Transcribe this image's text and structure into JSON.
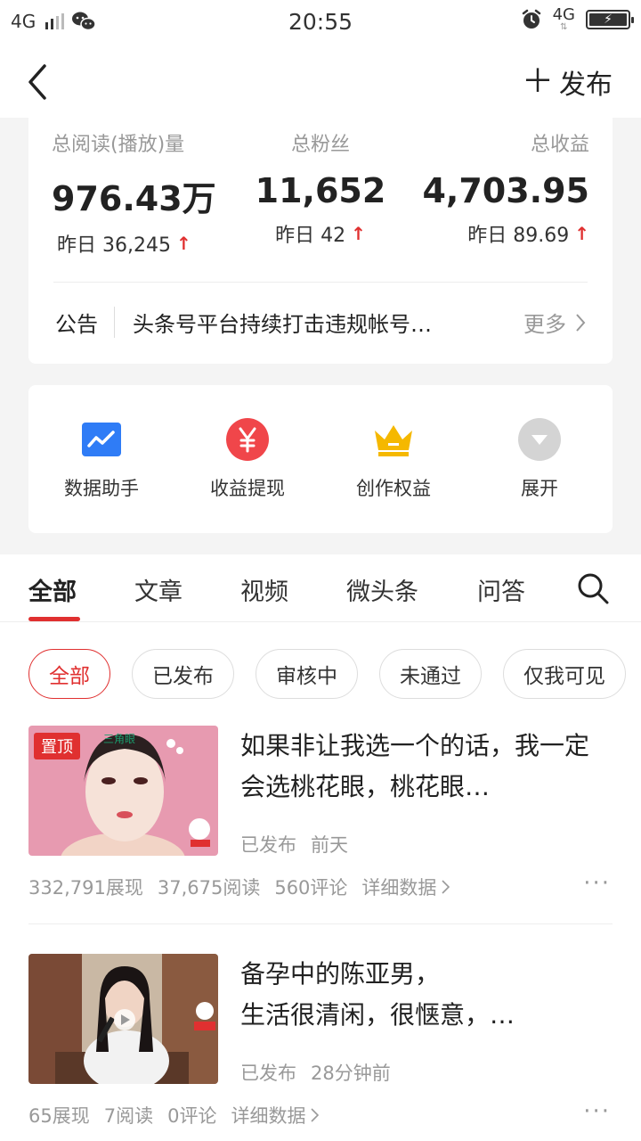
{
  "status_bar": {
    "network": "4G",
    "time": "20:55",
    "network_right": "4G"
  },
  "nav": {
    "publish_label": "发布"
  },
  "stats": [
    {
      "label": "总阅读(播放)量",
      "value": "976.43万",
      "delta": "昨日 36,245"
    },
    {
      "label": "总粉丝",
      "value": "11,652",
      "delta": "昨日 42"
    },
    {
      "label": "总收益",
      "value": "4,703.95",
      "delta": "昨日 89.69"
    }
  ],
  "notice": {
    "tag": "公告",
    "text": "头条号平台持续打击违规帐号…",
    "more": "更多"
  },
  "tools": [
    {
      "label": "数据助手",
      "icon": "chart-icon"
    },
    {
      "label": "收益提现",
      "icon": "yuan-icon"
    },
    {
      "label": "创作权益",
      "icon": "crown-icon"
    },
    {
      "label": "展开",
      "icon": "expand-icon"
    }
  ],
  "tabs": [
    "全部",
    "文章",
    "视频",
    "微头条",
    "问答"
  ],
  "filters": [
    "全部",
    "已发布",
    "审核中",
    "未通过",
    "仅我可见"
  ],
  "articles": [
    {
      "pin": "置顶",
      "thumb_caption": "三角眼",
      "title": "如果非让我选一个的话，我一定会选桃花眼，桃花眼…",
      "status": "已发布",
      "time": "前天",
      "impressions": "332,791展现",
      "reads": "37,675阅读",
      "comments": "560评论",
      "detail": "详细数据"
    },
    {
      "title": "备孕中的陈亚男，\n生活很清闲，很惬意，…",
      "status": "已发布",
      "time": "28分钟前",
      "impressions": "65展现",
      "reads": "7阅读",
      "comments": "0评论",
      "detail": "详细数据"
    }
  ],
  "colors": {
    "accent": "#e03030",
    "chart_blue": "#2f7cf6",
    "crown_yellow": "#f5b800"
  }
}
